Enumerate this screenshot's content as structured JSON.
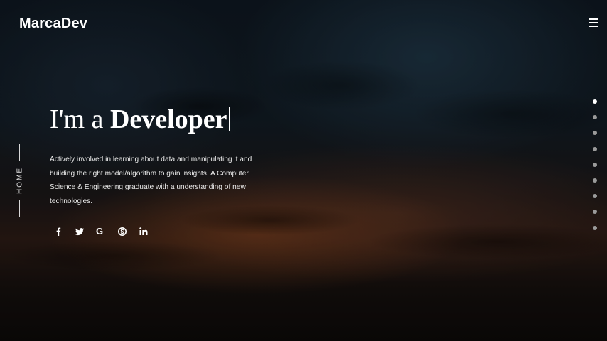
{
  "header": {
    "brand": "MarcaDev",
    "menu_icon": "hamburger-menu-icon"
  },
  "side_nav": {
    "label": "HOME"
  },
  "hero": {
    "intro": "I'm a",
    "role": "Developer",
    "description": "Actively involved in learning about data and manipulating it and building the right model/algorithm to gain insights. A Computer Science & Engineering graduate with a understanding of new technologies."
  },
  "social": [
    {
      "name": "facebook-icon"
    },
    {
      "name": "twitter-icon"
    },
    {
      "name": "google-icon",
      "glyph": "G"
    },
    {
      "name": "skype-icon"
    },
    {
      "name": "linkedin-icon"
    }
  ],
  "section_dots": {
    "count": 9,
    "active_index": 0
  },
  "colors": {
    "text": "#ffffff",
    "dot_inactive": "#9a9a9a",
    "dot_active": "#ffffff"
  }
}
